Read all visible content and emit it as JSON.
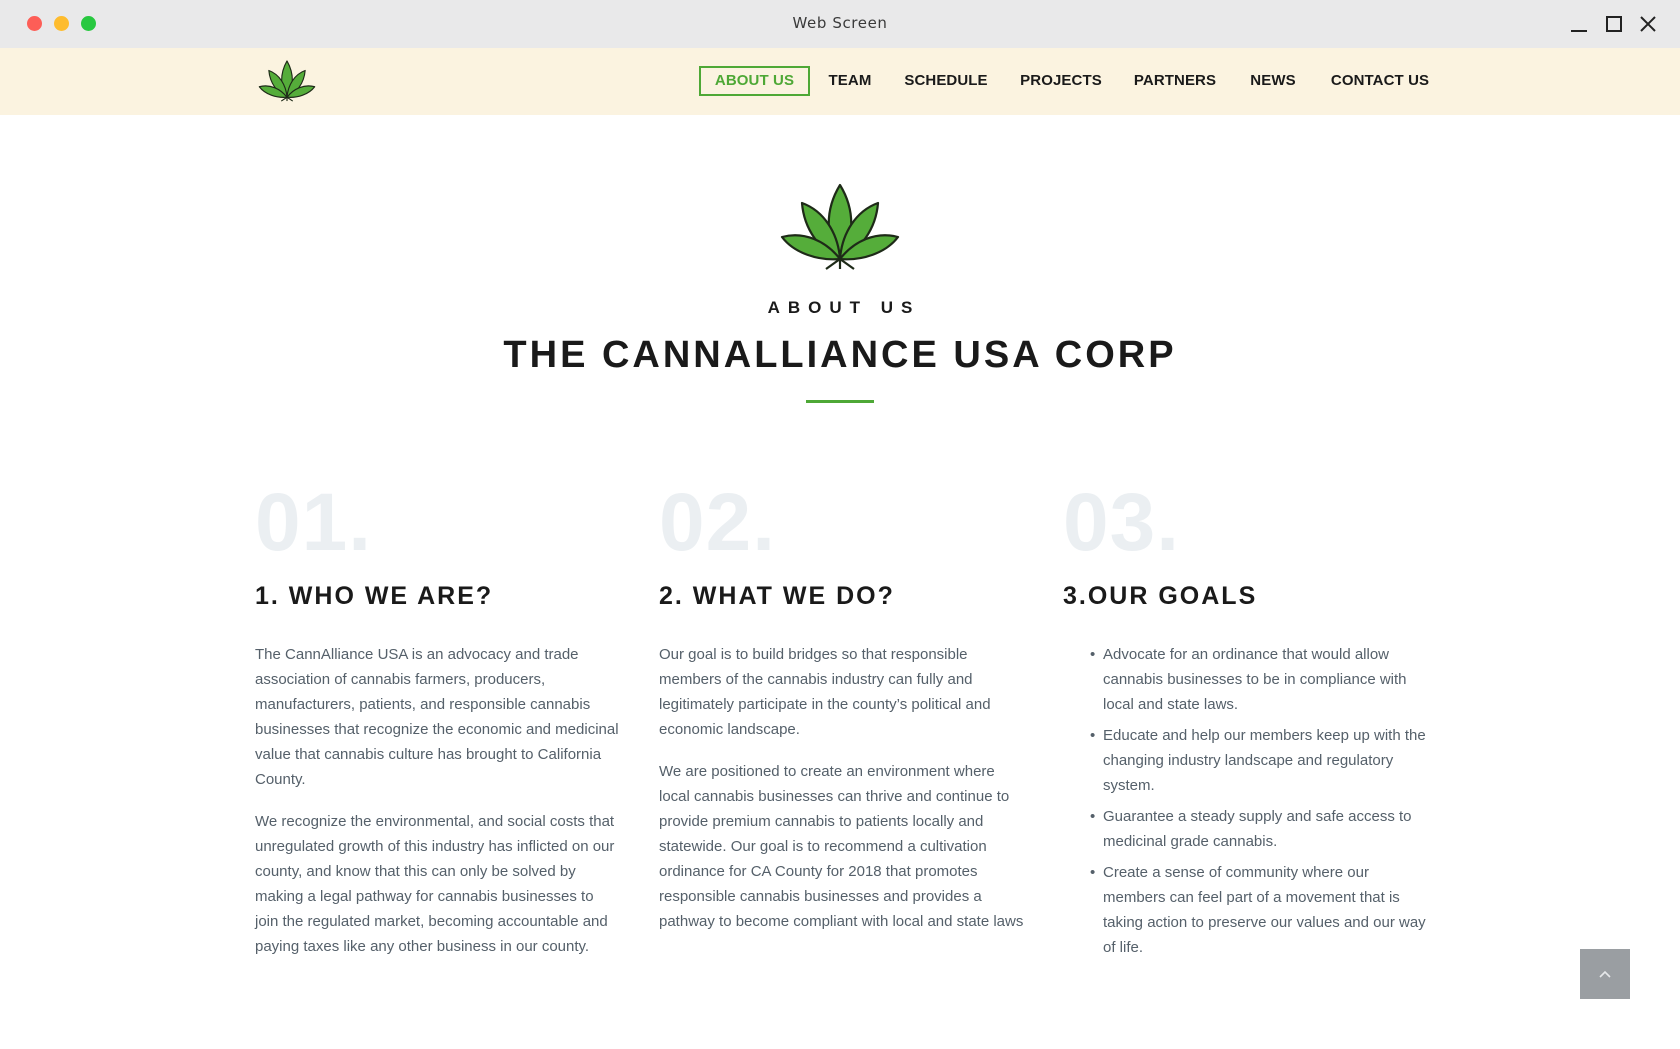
{
  "window": {
    "title": "Web Screen"
  },
  "nav": {
    "logo_icon": "cannabis-leaf-icon",
    "items": [
      {
        "label": "ABOUT US",
        "active": true
      },
      {
        "label": "TEAM",
        "active": false
      },
      {
        "label": "SCHEDULE",
        "active": false
      },
      {
        "label": "PROJECTS",
        "active": false
      },
      {
        "label": "PARTNERS",
        "active": false
      },
      {
        "label": "NEWS",
        "active": false
      },
      {
        "label": "CONTACT US",
        "active": false
      }
    ]
  },
  "hero": {
    "eyebrow": "ABOUT US",
    "title": "THE CANNALLIANCE USA CORP"
  },
  "columns": [
    {
      "number": "01.",
      "title": "1. WHO WE ARE?",
      "paragraphs": [
        "The CannAlliance USA is an advocacy and trade association of cannabis farmers, producers, manufacturers, patients, and responsible cannabis businesses that recognize the economic and medicinal value that cannabis culture has brought to California County.",
        "We recognize the environmental, and social costs that unregulated growth of this industry has inflicted on our county, and know that this can only be solved by making a legal pathway for cannabis businesses to join the regulated market, becoming accountable and paying taxes like any other business in our county."
      ]
    },
    {
      "number": "02.",
      "title": "2. WHAT WE DO?",
      "paragraphs": [
        "Our goal is to build bridges so that responsible members of the cannabis industry can fully and legitimately participate in the county’s political and economic landscape.",
        "We are positioned to create an environment where local cannabis businesses can thrive and continue to provide premium cannabis to patients locally and statewide. Our goal is to recommend a cultivation ordinance for CA County for 2018 that promotes responsible cannabis businesses and provides a pathway to become compliant with local and state laws"
      ]
    },
    {
      "number": "03.",
      "title": "3.OUR GOALS",
      "bullet": "•",
      "goals": [
        "Advocate for an ordinance that would allow cannabis businesses to be in compliance with local and state laws.",
        "Educate and help our members keep up with the changing industry landscape and regulatory system.",
        "Guarantee a steady supply and safe access to medicinal grade cannabis.",
        "Create a sense of community where our members can feel part of a movement that is taking action to preserve our values and our way of life."
      ]
    }
  ],
  "colors": {
    "accent": "#4ea836",
    "nav_bg": "#fbf3e0",
    "body_text": "#55606a",
    "big_number": "#ebeff2"
  },
  "back_to_top_icon": "chevron-up-icon"
}
